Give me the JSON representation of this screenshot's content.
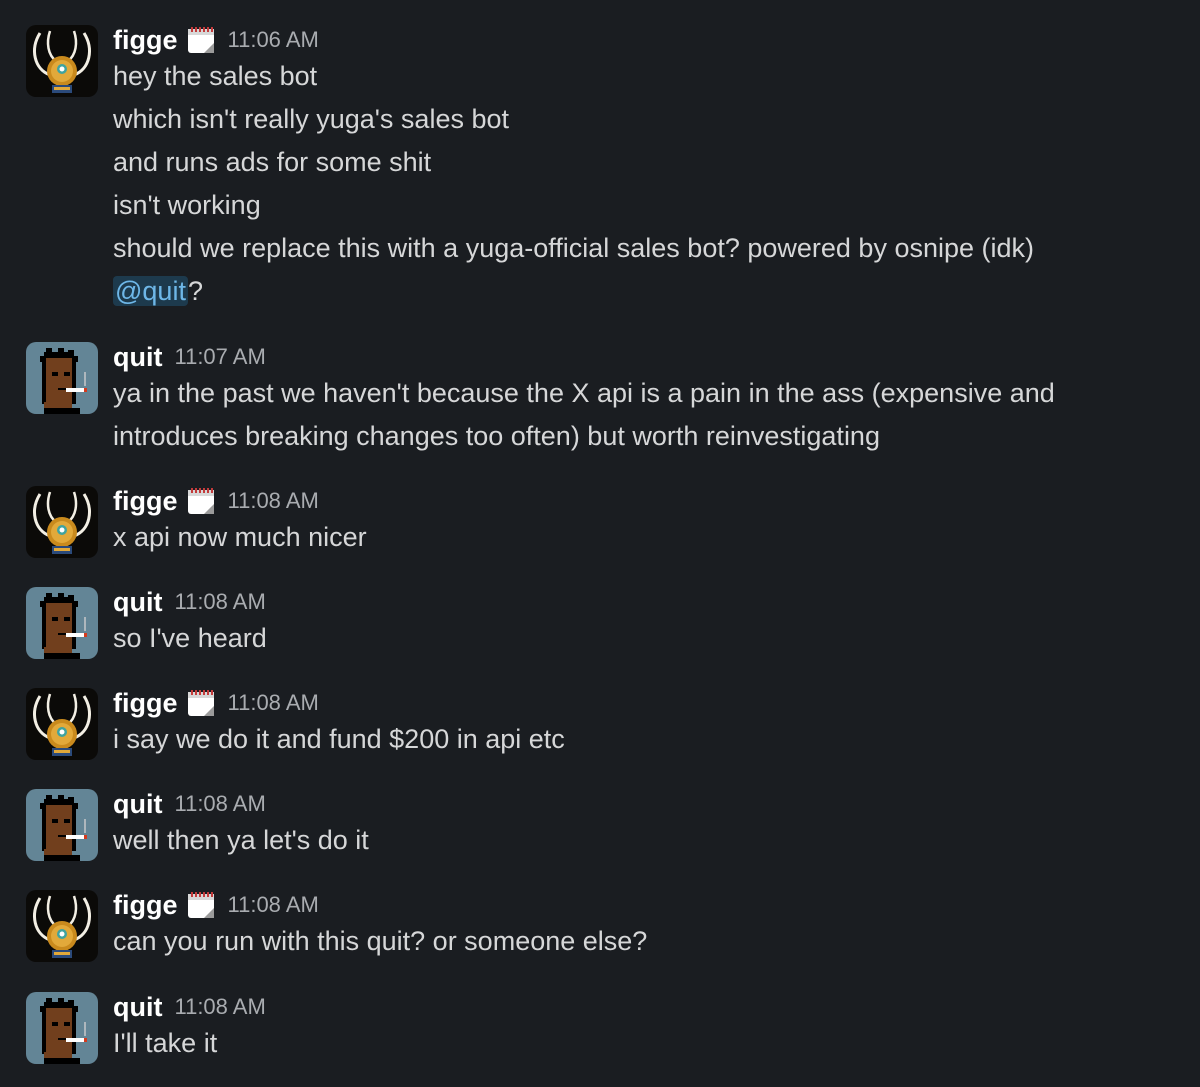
{
  "users": {
    "figge": {
      "name": "figge",
      "status_icon": "calendar-icon"
    },
    "quit": {
      "name": "quit"
    }
  },
  "messages": [
    {
      "user": "figge",
      "time": "11:06 AM",
      "lines": [
        "hey the sales bot",
        "which isn't really yuga's sales bot",
        "and runs ads for some shit",
        "isn't working",
        "should we replace this with a yuga-official sales bot?  powered by osnipe (idk)"
      ],
      "mention": "@quit",
      "mention_suffix": "?"
    },
    {
      "user": "quit",
      "time": "11:07 AM",
      "lines": [
        "ya in the past we haven't because the X api is a pain in the ass (expensive and",
        "introduces breaking changes too often) but worth reinvestigating"
      ]
    },
    {
      "user": "figge",
      "time": "11:08 AM",
      "lines": [
        "x api now much nicer"
      ]
    },
    {
      "user": "quit",
      "time": "11:08 AM",
      "lines": [
        "so I've heard"
      ]
    },
    {
      "user": "figge",
      "time": "11:08 AM",
      "lines": [
        "i say we do it and fund $200 in api etc"
      ]
    },
    {
      "user": "quit",
      "time": "11:08 AM",
      "lines": [
        "well then ya let's do it"
      ]
    },
    {
      "user": "figge",
      "time": "11:08 AM",
      "lines": [
        "can you run with this quit? or someone else?"
      ]
    },
    {
      "user": "quit",
      "time": "11:08 AM",
      "lines": [
        "I'll take it"
      ]
    }
  ],
  "colors": {
    "background": "#1a1d21",
    "name": "#ffffff",
    "text": "#d6d7d8",
    "timestamp": "#a9acb0",
    "mention_bg": "#1d3a4d",
    "mention_text": "#6eb7e8"
  }
}
